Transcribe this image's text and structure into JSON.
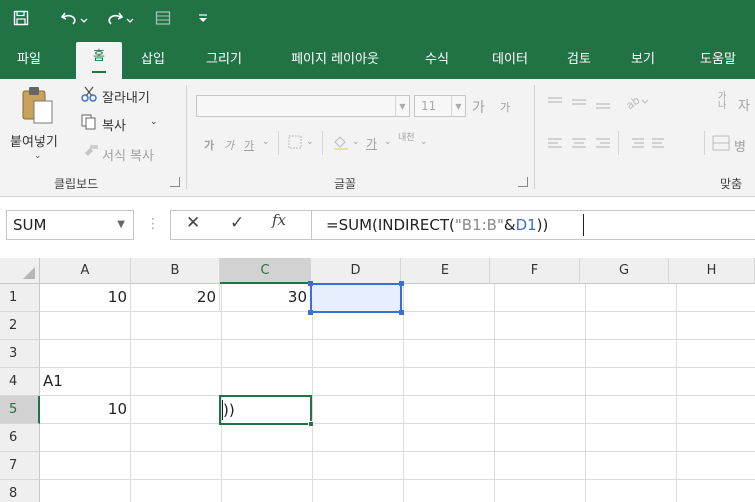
{
  "qat": {
    "save_icon": "save-icon",
    "undo_icon": "undo-icon",
    "redo_icon": "redo-icon",
    "form_icon": "form-icon",
    "customize_icon": "customize-qat-icon"
  },
  "tabs": [
    "파일",
    "홈",
    "삽입",
    "그리기",
    "페이지 레이아웃",
    "수식",
    "데이터",
    "검토",
    "보기",
    "도움말"
  ],
  "active_tab": "홈",
  "ribbon": {
    "clipboard": {
      "paste_label": "붙여넣기",
      "cut_label": "잘라내기",
      "copy_label": "복사",
      "format_painter_label": "서식 복사",
      "group_label": "클립보드"
    },
    "font": {
      "font_name": "",
      "font_size": "11",
      "group_label": "글꼴",
      "grow_glyph": "가",
      "shrink_glyph": "가",
      "bold_glyph": "가",
      "italic_glyph": "가",
      "underline_glyph": "가",
      "font_color_glyph": "가",
      "phonetic_glyph": "내천"
    },
    "alignment": {
      "group_label": "맞춤",
      "wrap_label": "자",
      "merge_label": "병"
    }
  },
  "formula_bar": {
    "name_box": "SUM",
    "cancel_glyph": "✕",
    "enter_glyph": "✓",
    "fx_glyph": "fx",
    "formula_prefix": "=SUM(INDIRECT(",
    "formula_string": "\"B1:B\"",
    "formula_amp": "&",
    "formula_ref": "D1",
    "formula_suffix": "))"
  },
  "grid": {
    "columns": [
      "A",
      "B",
      "C",
      "D",
      "E",
      "F",
      "G",
      "H"
    ],
    "rows": [
      "1",
      "2",
      "3",
      "4",
      "5",
      "6",
      "7",
      "8"
    ],
    "selected_column": "C",
    "selected_row": "5",
    "cells": {
      "A1": "10",
      "B1": "20",
      "C1": "30",
      "A4": "A1",
      "A5": "10",
      "C5": "))"
    }
  },
  "colors": {
    "brand": "#217346",
    "reference": "#3a6fd6"
  }
}
